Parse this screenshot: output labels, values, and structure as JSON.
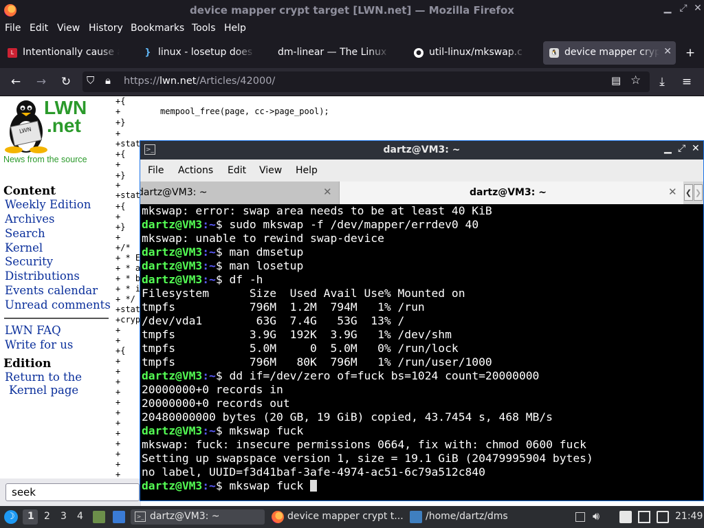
{
  "firefox": {
    "window_title": "device mapper crypt target [LWN.net] — Mozilla Firefox",
    "menu": [
      "File",
      "Edit",
      "View",
      "History",
      "Bookmarks",
      "Tools",
      "Help"
    ],
    "tabs": [
      {
        "label": "Intentionally cause a",
        "icon": "lwn-favicon-icon",
        "active": false
      },
      {
        "label": "linux - losetup does n",
        "icon": "stackexchange-icon",
        "active": false
      },
      {
        "label": "dm-linear — The Linux K",
        "icon": "none",
        "active": false
      },
      {
        "label": "util-linux/mkswap.c a",
        "icon": "github-icon",
        "active": false
      },
      {
        "label": "device mapper crypt",
        "icon": "lwn-favicon-icon",
        "active": true
      }
    ],
    "url": {
      "prefix": "https://",
      "host": "lwn.net",
      "path": "/Articles/42000/"
    }
  },
  "lwn": {
    "logo_line1": "LWN",
    "logo_line2": ".net",
    "tagline": "News from the source",
    "sections": [
      {
        "heading": "Content",
        "links": [
          "Weekly Edition",
          "Archives",
          "Search",
          "Kernel",
          "Security",
          "Distributions",
          "Events calendar",
          "Unread comments"
        ]
      },
      {
        "heading": "",
        "links": [
          "LWN FAQ",
          "Write for us"
        ]
      },
      {
        "heading": "Edition",
        "links": [
          "Return to the",
          "Kernel page"
        ]
      }
    ],
    "article_lines": [
      "+{",
      "+        mempool_free(page, cc->page_pool);",
      "+}",
      "+",
      "+stat",
      "+{",
      "+",
      "+}",
      "+",
      "+stat",
      "+{",
      "+",
      "+}",
      "+",
      "+/*",
      "+ * E",
      "+ * a",
      "+ * b",
      "+ * i",
      "+ */",
      "+stat",
      "+cryp",
      "+",
      "+",
      "+{",
      "+",
      "+",
      "+",
      "+",
      "+",
      "+",
      "+",
      "+",
      "+",
      "+",
      "+",
      "+"
    ],
    "find_value": "seek"
  },
  "terminal": {
    "title": "dartz@VM3: ~",
    "menu": [
      "File",
      "Actions",
      "Edit",
      "View",
      "Help"
    ],
    "tabs": [
      {
        "label": "dartz@VM3: ~",
        "active": false
      },
      {
        "label": "dartz@VM3: ~",
        "active": true
      }
    ],
    "prompt_user": "dartz@VM3",
    "prompt_path": ":~",
    "prompt_sym": "$ ",
    "lines": [
      {
        "type": "out",
        "text": "mkswap: error: swap area needs to be at least 40 KiB"
      },
      {
        "type": "cmd",
        "text": "sudo mkswap -f /dev/mapper/errdev0 40"
      },
      {
        "type": "out",
        "text": "mkswap: unable to rewind swap-device"
      },
      {
        "type": "cmd",
        "text": "man dmsetup"
      },
      {
        "type": "cmd",
        "text": "man losetup"
      },
      {
        "type": "cmd",
        "text": "df -h"
      },
      {
        "type": "out",
        "text": "Filesystem      Size  Used Avail Use% Mounted on"
      },
      {
        "type": "out",
        "text": "tmpfs           796M  1.2M  794M   1% /run"
      },
      {
        "type": "out",
        "text": "/dev/vda1        63G  7.4G   53G  13% /"
      },
      {
        "type": "out",
        "text": "tmpfs           3.9G  192K  3.9G   1% /dev/shm"
      },
      {
        "type": "out",
        "text": "tmpfs           5.0M     0  5.0M   0% /run/lock"
      },
      {
        "type": "out",
        "text": "tmpfs           796M   80K  796M   1% /run/user/1000"
      },
      {
        "type": "cmd",
        "text": "dd if=/dev/zero of=fuck bs=1024 count=20000000"
      },
      {
        "type": "out",
        "text": "20000000+0 records in"
      },
      {
        "type": "out",
        "text": "20000000+0 records out"
      },
      {
        "type": "out",
        "text": "20480000000 bytes (20 GB, 19 GiB) copied, 43.7454 s, 468 MB/s"
      },
      {
        "type": "cmd",
        "text": "mkswap fuck"
      },
      {
        "type": "out",
        "text": "mkswap: fuck: insecure permissions 0664, fix with: chmod 0600 fuck"
      },
      {
        "type": "out",
        "text": "Setting up swapspace version 1, size = 19.1 GiB (20479995904 bytes)"
      },
      {
        "type": "out",
        "text": "no label, UUID=f3d41baf-3afe-4974-ac51-6c79a512c840"
      },
      {
        "type": "cmd",
        "text": "mkswap fuck",
        "current": true
      }
    ]
  },
  "taskbar": {
    "workspaces": [
      "1",
      "2",
      "3",
      "4"
    ],
    "tasks": [
      {
        "label": "dartz@VM3: ~",
        "icon": "terminal-icon"
      },
      {
        "label": "device mapper crypt t...",
        "icon": "firefox-icon"
      },
      {
        "label": "/home/dartz/dms",
        "icon": "file-manager-icon"
      }
    ],
    "clock": "21:49"
  }
}
